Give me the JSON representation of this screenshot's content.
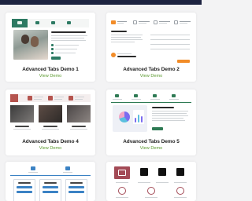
{
  "cards": [
    {
      "title": "Advanced Tabs Demo 1",
      "link": "View Demo"
    },
    {
      "title": "Advanced Tabs Demo 2",
      "link": "View Demo"
    },
    {
      "title": "Advanced Tabs Demo 4",
      "link": "View Demo"
    },
    {
      "title": "Advanced Tabs Demo 5",
      "link": "View Demo"
    }
  ],
  "colors": {
    "header": "#1d2340",
    "demo1_accent": "#2d7a63",
    "demo2_accent": "#f28c28",
    "demo4_accent": "#b5544e",
    "demo5_accent": "#2e7a54",
    "demo6_accent": "#a34a56",
    "link": "#5a9a2e"
  },
  "preview_icons": [
    "image-icon",
    "phone-icon",
    "lock-icon",
    "chart-icon",
    "document-icon"
  ]
}
